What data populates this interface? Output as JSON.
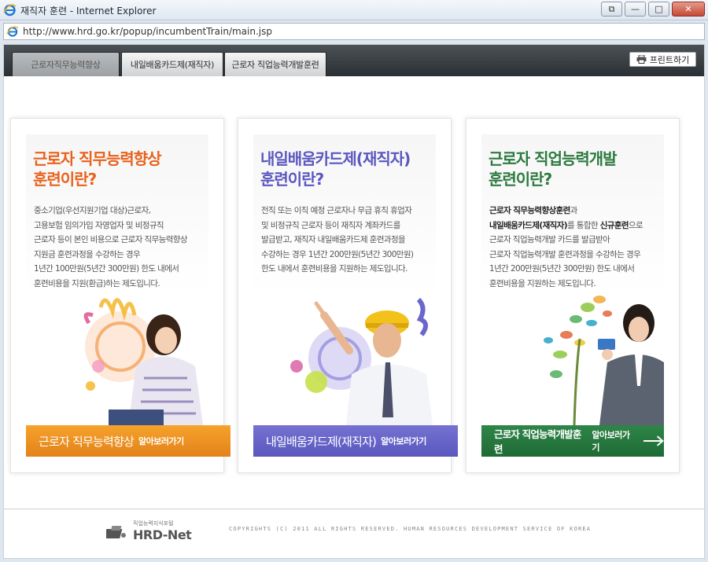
{
  "window": {
    "title": "재직자 훈련 - Internet Explorer",
    "buttons": {
      "restore_label": "⧉",
      "minimize_label": "—",
      "maximize_label": "□",
      "close_label": "✕"
    }
  },
  "address": {
    "url": "http://www.hrd.go.kr/popup/incumbentTrain/main.jsp"
  },
  "nav": {
    "tabs": [
      {
        "label": "근로자직무능력향상"
      },
      {
        "label": "내일배움카드제(재직자)"
      },
      {
        "label": "근로자 직업능력개발훈련"
      }
    ],
    "print_label": "프린트하기"
  },
  "cards": [
    {
      "heading_line1": "근로자 직무능력향상",
      "heading_line2": "훈련이란?",
      "desc": [
        "중소기업(우선지원기업 대상)근로자,",
        "고용보험 임의가입 자영업자 및 비정규직",
        "근로자 등이 본인 비용으로 근로자 직무능력향상",
        "지원금 훈련과정을 수강하는 경우",
        "1년간 100만원(5년간 300만원) 한도 내에서",
        "훈련비용을 지원(환급)하는 제도입니다."
      ],
      "cta_main": "근로자 직무능력향상",
      "cta_sub": "알아보러가기"
    },
    {
      "heading_line1": "내일배움카드제(재직자)",
      "heading_line2": "훈련이란?",
      "desc": [
        "전직 또는 이직 예정 근로자나 무급 휴직 휴업자",
        "및 비정규직 근로자 등이 재직자 계좌카드를",
        "발급받고, 재직자 내일배움카드제 훈련과정을",
        "수강하는 경우 1년간 200만원(5년간 300만원)",
        "한도 내에서 훈련비용을 지원하는 제도입니다."
      ],
      "cta_main": "내일배움카드제(재직자)",
      "cta_sub": "알아보러가기"
    },
    {
      "heading_line1": "근로자 직업능력개발",
      "heading_line2": "훈련이란?",
      "desc_rich": [
        {
          "bold": "근로자 직무능력향상훈련",
          "rest": "과"
        },
        {
          "bold": "내일배움카드제(재직자)",
          "mid": "를 통합한 ",
          "bold2": "신규훈련",
          "rest": "으로"
        }
      ],
      "desc": [
        "근로자 직업능력개발 카드를 발급받아",
        "근로자 직업능력개발 훈련과정을 수강하는 경우",
        "1년간 200만원(5년간 300만원) 한도 내에서",
        "훈련비용을 지원하는 제도입니다."
      ],
      "cta_main": "근로자 직업능력개발훈련",
      "cta_sub": "알아보러가기"
    }
  ],
  "footer": {
    "logo_caption": "직업능력지식포털",
    "logo_name": "HRD-Net",
    "copyright": "COPYRIGHTS (C) 2011 ALL RIGHTS RESERVED. HUMAN RESOURCES DEVELOPMENT SERVICE OF KOREA"
  },
  "colors": {
    "card1_accent": "#e8611c",
    "card2_accent": "#5a57bf",
    "card3_accent": "#1e6a36"
  }
}
